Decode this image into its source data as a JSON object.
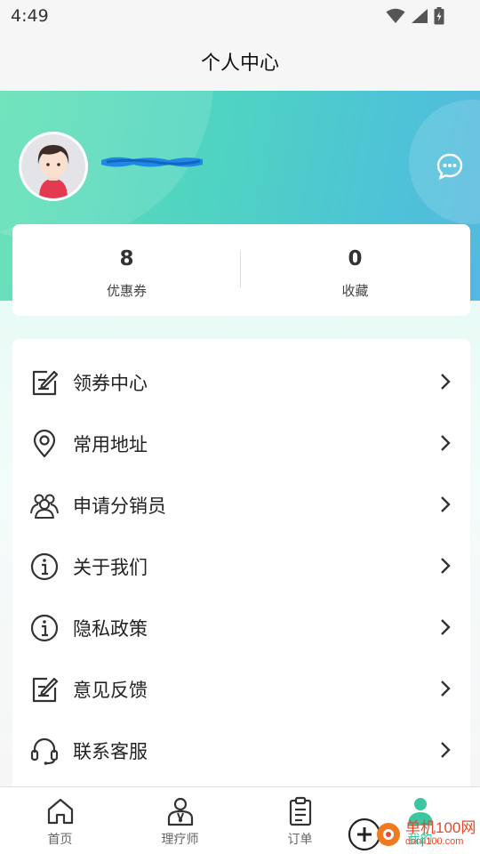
{
  "status_bar": {
    "time": "4:49"
  },
  "header": {
    "title": "个人中心"
  },
  "profile": {
    "name_redacted": "redacted phone number"
  },
  "stats": [
    {
      "value": "8",
      "label": "优惠券"
    },
    {
      "value": "0",
      "label": "收藏"
    }
  ],
  "menu": [
    {
      "label": "领券中心",
      "icon": "edit-note-icon"
    },
    {
      "label": "常用地址",
      "icon": "location-pin-icon"
    },
    {
      "label": "申请分销员",
      "icon": "group-icon"
    },
    {
      "label": "关于我们",
      "icon": "info-icon"
    },
    {
      "label": "隐私政策",
      "icon": "info-icon"
    },
    {
      "label": "意见反馈",
      "icon": "edit-note-icon"
    },
    {
      "label": "联系客服",
      "icon": "headset-icon"
    }
  ],
  "tabs": [
    {
      "label": "首页",
      "icon": "home-icon"
    },
    {
      "label": "理疗师",
      "icon": "therapist-icon"
    },
    {
      "label": "订单",
      "icon": "clipboard-icon"
    },
    {
      "label": "我的",
      "icon": "user-icon",
      "active": true
    }
  ],
  "watermark": {
    "line1": "单机100网",
    "line2": "danji100.com"
  },
  "colors": {
    "accent": "#3bc6a0",
    "hero_start": "#5fe0b4",
    "hero_end": "#55b8e0",
    "watermark": "#e8472b"
  }
}
